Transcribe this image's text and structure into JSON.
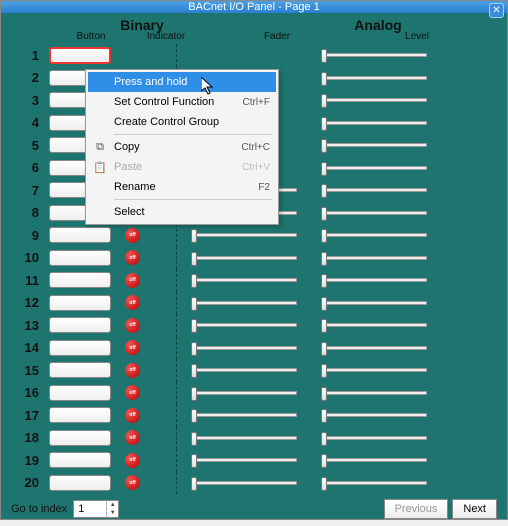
{
  "window": {
    "title": "BACnet I/O Panel - Page 1"
  },
  "headers": {
    "binary": "Binary",
    "analog": "Analog"
  },
  "subheaders": {
    "button": "Button",
    "indicator": "Indicator",
    "fader": "Fader",
    "level": "Level"
  },
  "rows": [
    {
      "n": "1"
    },
    {
      "n": "2"
    },
    {
      "n": "3"
    },
    {
      "n": "4"
    },
    {
      "n": "5"
    },
    {
      "n": "6"
    },
    {
      "n": "7"
    },
    {
      "n": "8"
    },
    {
      "n": "9"
    },
    {
      "n": "10"
    },
    {
      "n": "11"
    },
    {
      "n": "12"
    },
    {
      "n": "13"
    },
    {
      "n": "14"
    },
    {
      "n": "15"
    },
    {
      "n": "16"
    },
    {
      "n": "17"
    },
    {
      "n": "18"
    },
    {
      "n": "19"
    },
    {
      "n": "20"
    }
  ],
  "indicator_text": "off",
  "context_menu": {
    "items": [
      {
        "label": "Press and hold",
        "shortcut": "",
        "kind": "item",
        "highlight": true
      },
      {
        "label": "Set Control Function",
        "shortcut": "Ctrl+F",
        "kind": "item"
      },
      {
        "label": "Create Control Group",
        "shortcut": "",
        "kind": "item"
      },
      {
        "kind": "sep"
      },
      {
        "label": "Copy",
        "shortcut": "Ctrl+C",
        "kind": "item",
        "icon": "copy"
      },
      {
        "label": "Paste",
        "shortcut": "Ctrl+V",
        "kind": "item",
        "disabled": true,
        "icon": "paste"
      },
      {
        "label": "Rename",
        "shortcut": "F2",
        "kind": "item"
      },
      {
        "kind": "sep"
      },
      {
        "label": "Select",
        "shortcut": "",
        "kind": "item"
      }
    ]
  },
  "footer": {
    "go_label": "Go to index",
    "index_value": "1",
    "prev": "Previous",
    "next": "Next"
  }
}
